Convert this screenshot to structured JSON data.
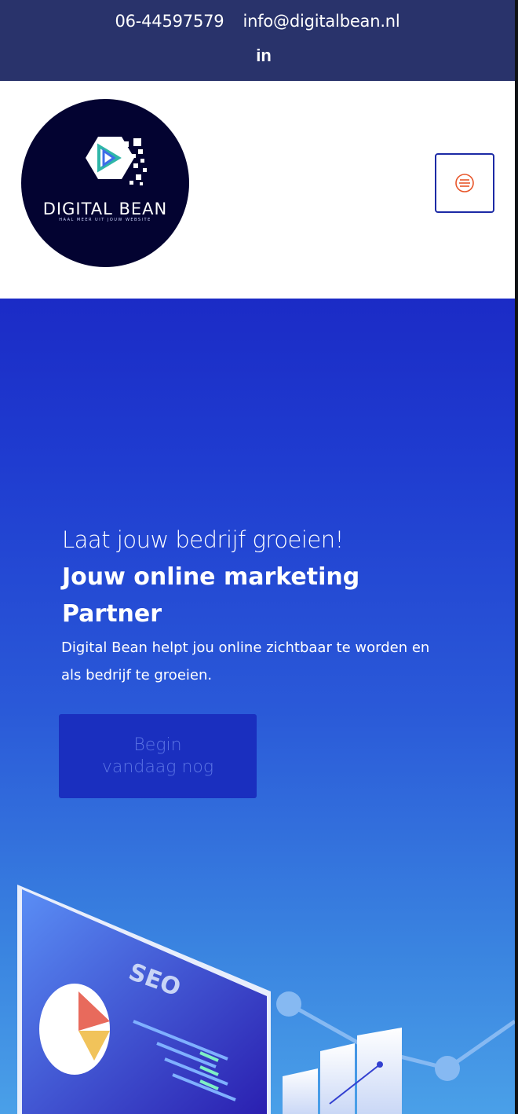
{
  "topbar": {
    "phone": "06-44597579",
    "email": "info@digitalbean.nl",
    "social_icon": "linkedin-icon",
    "social_label": "in"
  },
  "header": {
    "logo": {
      "wordmark": "DIGITAL BEAN",
      "tagline": "HAAL MEER UIT JOUW WEBSITE"
    },
    "menu_icon": "hamburger-menu-icon"
  },
  "hero": {
    "subtitle": "Laat jouw bedrijf groeien!",
    "title": "Jouw online marketing Partner",
    "description": "Digital Bean helpt jou online zichtbaar te worden en als bedrijf te groeien.",
    "cta_label": "Begin vandaag nog",
    "illustration": {
      "screen_label": "SEO"
    }
  },
  "colors": {
    "topbar_bg": "#29336b",
    "hero_top": "#1b2bc6",
    "hero_bottom": "#4aa0e8",
    "menu_icon": "#e8562a",
    "menu_border": "#1c2aa5",
    "cta_bg": "#1a2fbf",
    "logo_bg": "#030331"
  }
}
